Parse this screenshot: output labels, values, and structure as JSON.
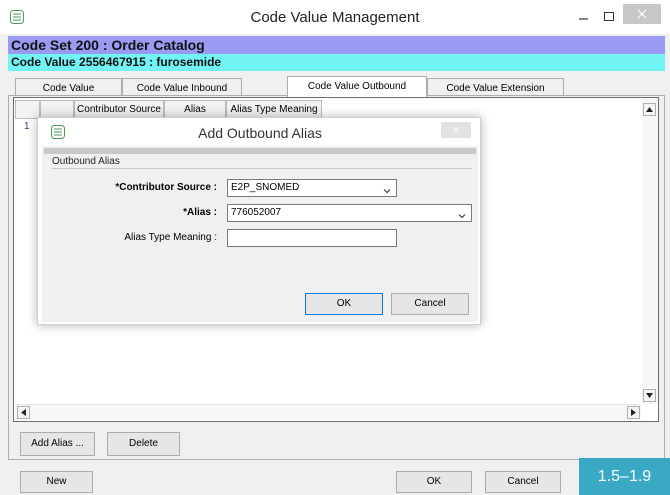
{
  "window": {
    "title": "Code Value Management",
    "controls": {
      "minimize": "–",
      "maximize": "☐",
      "close": "✕"
    }
  },
  "code_set_bar": "Code Set 200 : Order Catalog",
  "code_value_bar": "Code Value 2556467915 : furosemide",
  "tabs": [
    "Code Value",
    "Code Value Inbound",
    "Code Value Outbound",
    "Code Value Extension"
  ],
  "active_tab": "Code Value Outbound",
  "grid": {
    "columns": [
      "Contributor Source",
      "Alias",
      "Alias Type Meaning"
    ],
    "rows": [
      {
        "num": "1"
      }
    ]
  },
  "buttons": {
    "add_alias": "Add Alias ...",
    "delete": "Delete",
    "new": "New",
    "ok": "OK",
    "cancel": "Cancel"
  },
  "version_badge": "1.5–1.9",
  "dialog": {
    "title": "Add Outbound Alias",
    "group_label": "Outbound Alias",
    "fields": {
      "contributor_source": {
        "label": "*Contributor Source :",
        "value": "E2P_SNOMED"
      },
      "alias": {
        "label": "*Alias :",
        "value": "776052007"
      },
      "alias_type_meaning": {
        "label": "Alias Type Meaning :",
        "value": ""
      }
    },
    "ok": "OK",
    "cancel": "Cancel"
  },
  "colors": {
    "code_set_bar": "#9a9af2",
    "code_value_bar": "#73f4f4",
    "version_badge": "#3aa9c6"
  }
}
